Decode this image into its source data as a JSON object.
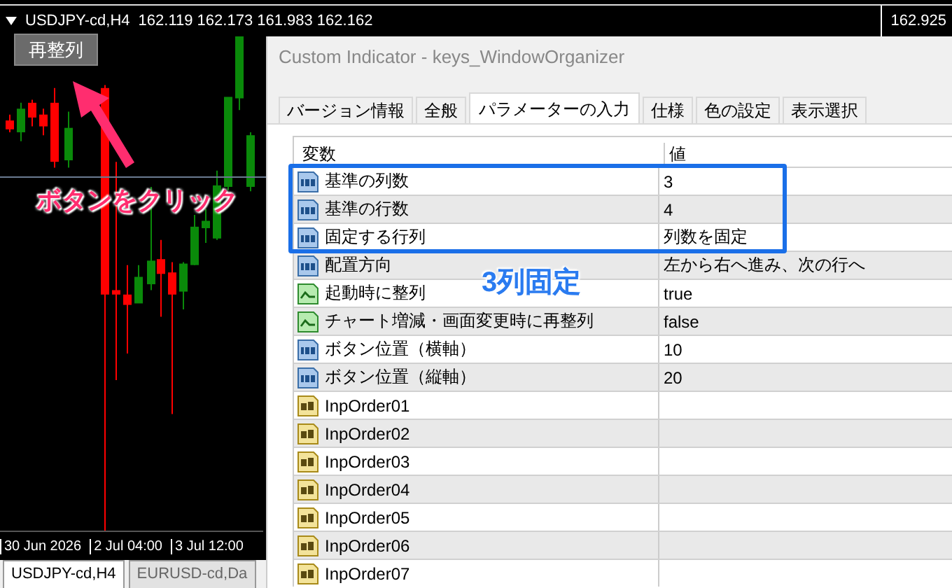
{
  "chart": {
    "title": "USDJPY-cd,H4",
    "prices": "162.119 162.173 161.983 162.162",
    "price_label": "162.925",
    "button": "再整列",
    "time_labels": [
      "30 Jun 2026",
      "2 Jul 04:00",
      "3 Jul 12:00"
    ],
    "tabs": [
      {
        "label": "USDJPY-cd,H4",
        "selected": true
      },
      {
        "label": "EURUSD-cd,Da",
        "selected": false
      }
    ]
  },
  "dialog": {
    "title": "Custom Indicator - keys_WindowOrganizer",
    "tabs": [
      {
        "label": "バージョン情報",
        "selected": false
      },
      {
        "label": "全般",
        "selected": false
      },
      {
        "label": "パラメーターの入力",
        "selected": true
      },
      {
        "label": "仕様",
        "selected": false
      },
      {
        "label": "色の設定",
        "selected": false
      },
      {
        "label": "表示選択",
        "selected": false
      }
    ],
    "table": {
      "columns": [
        "変数",
        "値"
      ],
      "rows": [
        {
          "kind": "int",
          "name": "基準の列数",
          "value": "3"
        },
        {
          "kind": "int",
          "name": "基準の行数",
          "value": "4"
        },
        {
          "kind": "int",
          "name": "固定する行列",
          "value": "列数を固定"
        },
        {
          "kind": "int",
          "name": "配置方向",
          "value": "左から右へ進み、次の行へ"
        },
        {
          "kind": "bool",
          "name": "起動時に整列",
          "value": "true"
        },
        {
          "kind": "bool",
          "name": "チャート増減・画面変更時に再整列",
          "value": "false"
        },
        {
          "kind": "int",
          "name": "ボタン位置（横軸）",
          "value": "10"
        },
        {
          "kind": "int",
          "name": "ボタン位置（縦軸）",
          "value": "20"
        },
        {
          "kind": "string",
          "name": "InpOrder01"
        },
        {
          "kind": "string",
          "name": "InpOrder02"
        },
        {
          "kind": "string",
          "name": "InpOrder03"
        },
        {
          "kind": "string",
          "name": "InpOrder04"
        },
        {
          "kind": "string",
          "name": "InpOrder05"
        },
        {
          "kind": "string",
          "name": "InpOrder06"
        },
        {
          "kind": "string",
          "name": "InpOrder07"
        }
      ]
    }
  },
  "annotations": {
    "click_note": "ボタンをクリック",
    "fixed_note": "3列固定"
  }
}
